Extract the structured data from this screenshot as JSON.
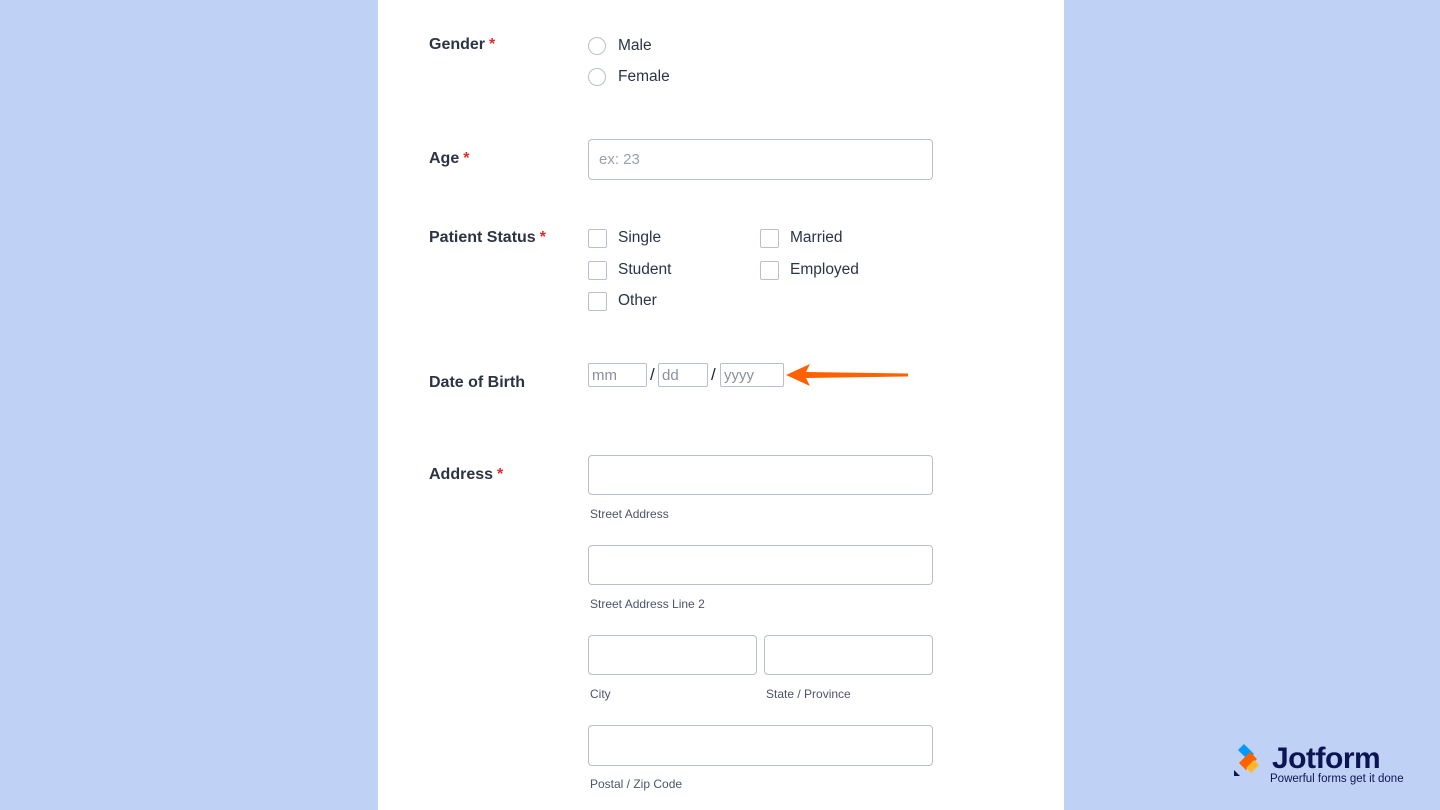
{
  "gender": {
    "label": "Gender",
    "required_mark": "*",
    "options": [
      "Male",
      "Female"
    ]
  },
  "age": {
    "label": "Age",
    "required_mark": "*",
    "placeholder": "ex: 23"
  },
  "patient_status": {
    "label": "Patient Status",
    "required_mark": "*",
    "options": [
      "Single",
      "Married",
      "Student",
      "Employed",
      "Other"
    ]
  },
  "dob": {
    "label": "Date of Birth",
    "mm_placeholder": "mm",
    "dd_placeholder": "dd",
    "yyyy_placeholder": "yyyy",
    "separator": "/"
  },
  "address": {
    "label": "Address",
    "required_mark": "*",
    "street_sublabel": "Street Address",
    "street2_sublabel": "Street Address Line 2",
    "city_sublabel": "City",
    "state_sublabel": "State / Province",
    "zip_sublabel": "Postal / Zip Code"
  },
  "brand": {
    "name": "Jotform",
    "tagline": "Powerful forms get it done",
    "accent": "#ff6100"
  }
}
